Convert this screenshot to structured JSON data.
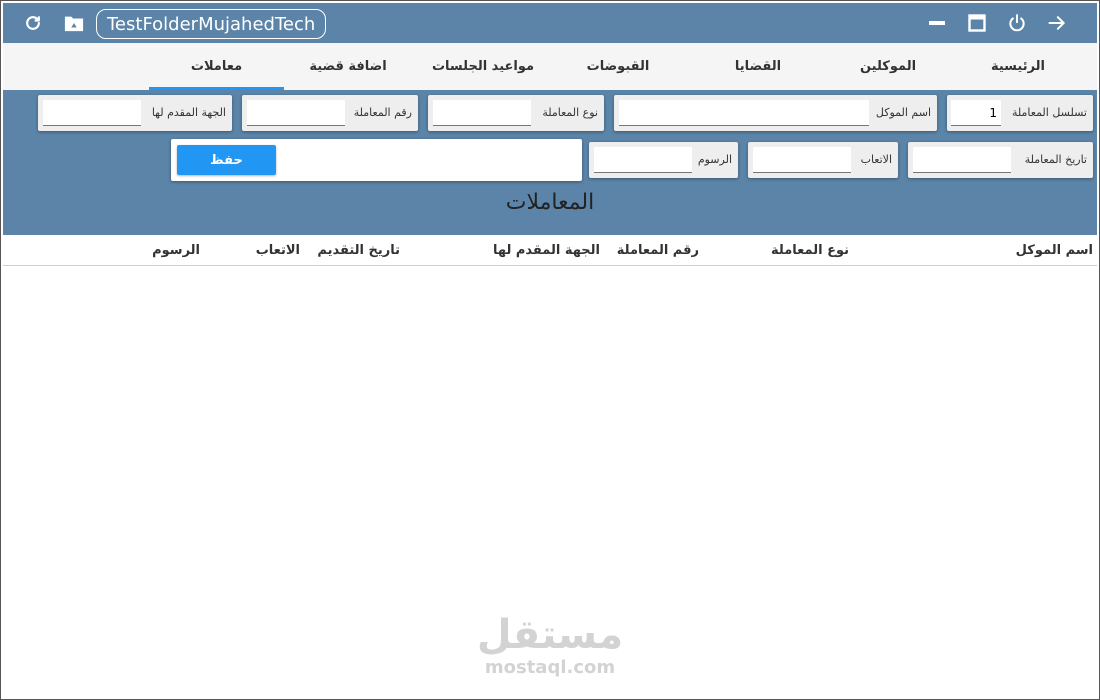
{
  "titlebar": {
    "app_title": "TestFolderMujahedTech",
    "left_icons": [
      "refresh-icon",
      "folder-drive-icon"
    ],
    "right_icons": [
      "minimize-icon",
      "maximize-icon",
      "power-icon",
      "arrow-right-icon"
    ]
  },
  "tabs": [
    {
      "label": "الرئيسية"
    },
    {
      "label": "الموكلين"
    },
    {
      "label": "القضايا"
    },
    {
      "label": "القبوضات"
    },
    {
      "label": "مواعيد الجلسات"
    },
    {
      "label": "اضافة قضية"
    },
    {
      "label": "معاملات",
      "active": true
    }
  ],
  "form": {
    "sequence": {
      "label": "تسلسل المعاملة",
      "value": "1"
    },
    "client_name": {
      "label": "اسم الموكل",
      "value": ""
    },
    "transaction_type": {
      "label": "نوع المعاملة",
      "value": ""
    },
    "transaction_number": {
      "label": "رقم المعاملة",
      "value": ""
    },
    "submitted_to": {
      "label": "الجهة المقدم لها",
      "value": ""
    },
    "transaction_date": {
      "label": "تاريخ المعاملة",
      "value": ""
    },
    "fees_lawyer": {
      "label": "الاتعاب",
      "value": ""
    },
    "fees": {
      "label": "الرسوم",
      "value": ""
    },
    "save_label": "حفظ",
    "section_title": "المعاملات"
  },
  "table": {
    "columns": [
      "اسم الموكل",
      "نوع المعاملة",
      "رقم المعاملة",
      "الجهة المقدم لها",
      "تاريخ التقديم",
      "الاتعاب",
      "الرسوم"
    ],
    "rows": []
  },
  "watermark": {
    "logo": "مستقل",
    "url": "mostaql.com"
  },
  "colors": {
    "header_bg": "#5b84a8",
    "accent": "#2196f3",
    "tab_bg": "#f5f5f5"
  }
}
